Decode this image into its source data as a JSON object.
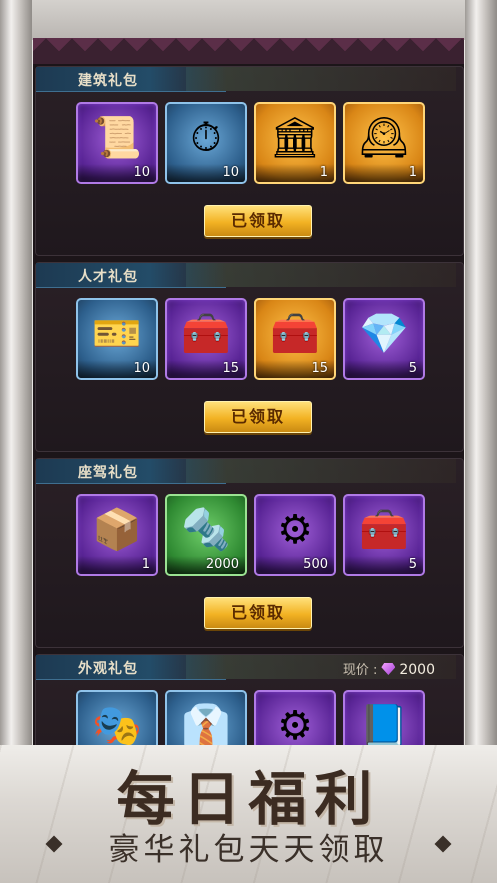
{
  "sections": [
    {
      "title": "建筑礼包",
      "claim_label": "已领取",
      "items": [
        {
          "icon": "certificate-icon",
          "quality": "purple",
          "glyph": "📜",
          "qty": "10"
        },
        {
          "icon": "stopwatch-icon",
          "quality": "blue",
          "glyph": "⏱",
          "qty": "10"
        },
        {
          "icon": "blueprint-icon",
          "quality": "gold",
          "glyph": "🏛",
          "qty": "1"
        },
        {
          "icon": "pocket-watch-icon",
          "quality": "gold",
          "glyph": "🕰",
          "qty": "1"
        }
      ]
    },
    {
      "title": "人才礼包",
      "claim_label": "已领取",
      "items": [
        {
          "icon": "elite-recruit-ticket-icon",
          "quality": "blue",
          "glyph": "🎫",
          "qty": "10"
        },
        {
          "icon": "purple-ticket-chest-icon",
          "quality": "purple",
          "glyph": "🧰",
          "qty": "15"
        },
        {
          "icon": "gold-ticket-chest-icon",
          "quality": "gold",
          "glyph": "🧰",
          "qty": "15"
        },
        {
          "icon": "gem-chest-icon",
          "quality": "purple",
          "glyph": "💎",
          "qty": "5"
        }
      ]
    },
    {
      "title": "座驾礼包",
      "claim_label": "已领取",
      "items": [
        {
          "icon": "car-crate-icon",
          "quality": "purple",
          "glyph": "📦",
          "qty": "1"
        },
        {
          "icon": "steel-ingot-icon",
          "quality": "green",
          "glyph": "🔩",
          "qty": "2000"
        },
        {
          "icon": "gear-spring-icon",
          "quality": "purple",
          "glyph": "⚙",
          "qty": "500"
        },
        {
          "icon": "gold-chest-icon",
          "quality": "purple",
          "glyph": "🧰",
          "qty": "5"
        }
      ]
    },
    {
      "title": "外观礼包",
      "price_label": "现价 :",
      "price_value": "2000",
      "items": [
        {
          "icon": "mask-coupon-icon",
          "quality": "blue",
          "glyph": "🎭",
          "qty": ""
        },
        {
          "icon": "outfit-coupon-icon",
          "quality": "blue",
          "glyph": "👔",
          "qty": ""
        },
        {
          "icon": "gear-spring-icon",
          "quality": "purple",
          "glyph": "⚙",
          "qty": ""
        },
        {
          "icon": "plan-book-icon",
          "quality": "purple",
          "glyph": "📘",
          "qty": ""
        }
      ]
    }
  ],
  "banner": {
    "title": "每日福利",
    "subtitle": "豪华礼包天天领取"
  },
  "colors": {
    "panel_bg": "#1c1519",
    "claim_button": "#f2b223",
    "section_header": "#234c68"
  }
}
